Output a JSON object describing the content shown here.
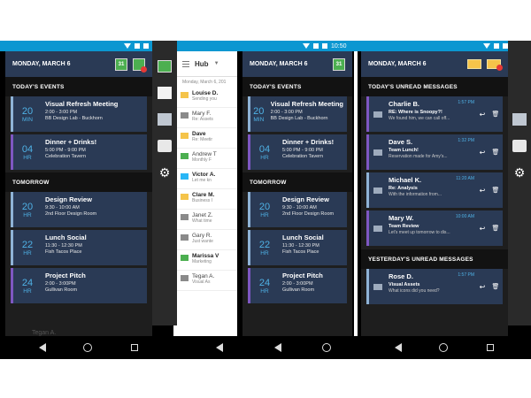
{
  "status": {
    "time": "10:50"
  },
  "screen1": {
    "date": "MONDAY, MARCH 6",
    "cal_day": "31",
    "sections": {
      "today": "TODAY'S EVENTS",
      "tomorrow": "TOMORROW"
    },
    "today_events": [
      {
        "num": "20",
        "unit": "MIN",
        "title": "Visual Refresh Meeting",
        "time": "2:00 - 3:00 PM",
        "place": "BB Design Lab - Buckhorn"
      },
      {
        "num": "04",
        "unit": "HR",
        "title": "Dinner + Drinks!",
        "time": "5:00 PM - 9:00 PM",
        "place": "Celebration Tavern"
      }
    ],
    "tomorrow_events": [
      {
        "num": "20",
        "unit": "HR",
        "title": "Design Review",
        "time": "9:30 - 10:00 AM",
        "place": "2nd Floor Design Room"
      },
      {
        "num": "22",
        "unit": "HR",
        "title": "Lunch Social",
        "time": "11:30 - 12:30 PM",
        "place": "Fish Tacos Place"
      },
      {
        "num": "24",
        "unit": "HR",
        "title": "Project Pitch",
        "time": "2:00 - 3:00PM",
        "place": "Gullivan Room"
      }
    ],
    "footer_name": "Tegan A."
  },
  "hub": {
    "title": "Hub",
    "date": "Monday, March 6, 201",
    "items": [
      {
        "icon": "mail",
        "name": "Louise D.",
        "sub": "Sending you",
        "bold": true
      },
      {
        "icon": "open",
        "name": "Mary F.",
        "sub": "Re: Assets",
        "bold": false
      },
      {
        "icon": "mail",
        "name": "Dave",
        "sub": "Re: Meetir",
        "bold": true
      },
      {
        "icon": "cal",
        "name": "Andrew T",
        "sub": "Monthly F",
        "bold": false
      },
      {
        "icon": "chat",
        "name": "Victor A.",
        "sub": "Let me kn",
        "bold": true
      },
      {
        "icon": "mail",
        "name": "Clare M.",
        "sub": "Business I",
        "bold": true
      },
      {
        "icon": "open",
        "name": "Janet Z.",
        "sub": "What time",
        "bold": false
      },
      {
        "icon": "open",
        "name": "Gary R.",
        "sub": "Just wante",
        "bold": false
      },
      {
        "icon": "cal",
        "name": "Marissa V",
        "sub": "Marketing",
        "bold": true
      },
      {
        "icon": "open",
        "name": "Tegan A.",
        "sub": "Visual As",
        "bold": false
      }
    ]
  },
  "screen3": {
    "date": "MONDAY, MARCH 6",
    "cal_day": "31",
    "sections": {
      "today": "TODAY'S EVENTS",
      "tomorrow": "TOMORROW"
    },
    "today_events": [
      {
        "num": "20",
        "unit": "MIN",
        "title": "Visual Refresh Meeting",
        "time": "2:00 - 3:00 PM",
        "place": "BB Design Lab - Buckhorn"
      },
      {
        "num": "04",
        "unit": "HR",
        "title": "Dinner + Drinks!",
        "time": "5:00 PM - 9:00 PM",
        "place": "Celebration Tavern"
      }
    ],
    "tomorrow_events": [
      {
        "num": "20",
        "unit": "HR",
        "title": "Design Review",
        "time": "9:30 - 10:00 AM",
        "place": "2nd Floor Design Room"
      },
      {
        "num": "22",
        "unit": "HR",
        "title": "Lunch Social",
        "time": "11:30 - 12:30 PM",
        "place": "Fish Tacos Place"
      },
      {
        "num": "24",
        "unit": "HR",
        "title": "Project Pitch",
        "time": "2:00 - 3:00PM",
        "place": "Gullivan Room"
      }
    ]
  },
  "screen4": {
    "date": "MONDAY, MARCH 6",
    "sections": {
      "today": "TODAY'S UNREAD MESSAGES",
      "yesterday": "YESTERDAY'S UNREAD MESSAGES"
    },
    "today_messages": [
      {
        "sender": "Charlie B.",
        "time": "1:57 PM",
        "subject": "RE: Where is Snoopy?!",
        "preview": "We found him, we can call off..."
      },
      {
        "sender": "Dave S.",
        "time": "1:32 PM",
        "subject": "Team Lunch!",
        "preview": "Reservation made for Amy's..."
      },
      {
        "sender": "Michael K.",
        "time": "11:20 AM",
        "subject": "Re: Analysis",
        "preview": "With the information from..."
      },
      {
        "sender": "Mary W.",
        "time": "10:00 AM",
        "subject": "Team Review",
        "preview": "Let's meet up tomorrow to dis..."
      }
    ],
    "yesterday_messages": [
      {
        "sender": "Rose D.",
        "time": "1:57 PM",
        "subject": "Visual Assets",
        "preview": "What icons did you need?"
      }
    ]
  }
}
